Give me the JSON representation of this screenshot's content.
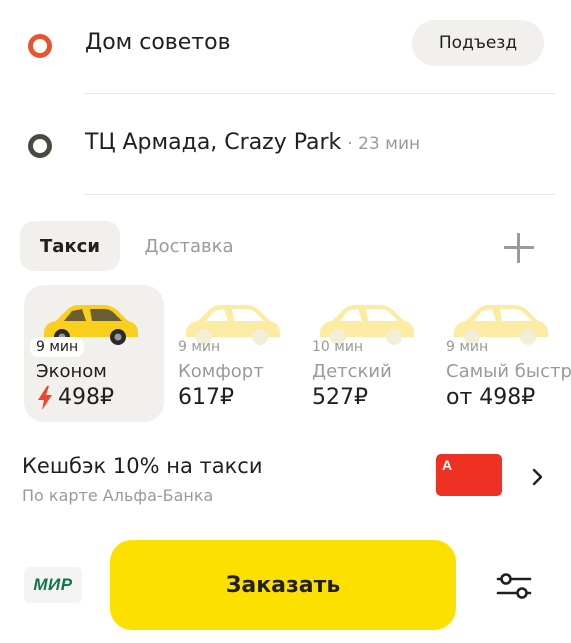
{
  "route": {
    "from": {
      "address": "Дом советов",
      "entrance_label": "Подъезд"
    },
    "to": {
      "address": "ТЦ Армада, Crazy Park",
      "eta": "· 23 мин"
    }
  },
  "tabs": [
    {
      "label": "Такси",
      "active": true
    },
    {
      "label": "Доставка",
      "active": false
    }
  ],
  "tariffs": [
    {
      "name": "Эконом",
      "time": "9 мин",
      "price": "498₽",
      "selected": true,
      "surge": true
    },
    {
      "name": "Комфорт",
      "time": "9 мин",
      "price": "617₽",
      "selected": false,
      "surge": false
    },
    {
      "name": "Детский",
      "time": "10 мин",
      "price": "527₽",
      "selected": false,
      "surge": false
    },
    {
      "name": "Самый быстрый",
      "time": "9 мин",
      "price": "от 498₽",
      "selected": false,
      "surge": false
    }
  ],
  "cashback": {
    "title": "Кешбэк 10% на такси",
    "subtitle": "По карте Альфа-Банка",
    "bank_logo": "А"
  },
  "payment": {
    "method_logo": "МИР"
  },
  "order_button": {
    "label": "Заказать"
  },
  "colors": {
    "accent_yellow": "#fce000",
    "pin_from": "#e8542f",
    "pin_to": "#4a4a3e",
    "surge_red": "#f0442c",
    "alfa_red": "#ef3124",
    "mir_green": "#0f754e"
  },
  "icons": {
    "add_stop": "plus-icon",
    "surge": "lightning-icon",
    "next": "chevron-right-icon",
    "settings": "sliders-icon"
  }
}
